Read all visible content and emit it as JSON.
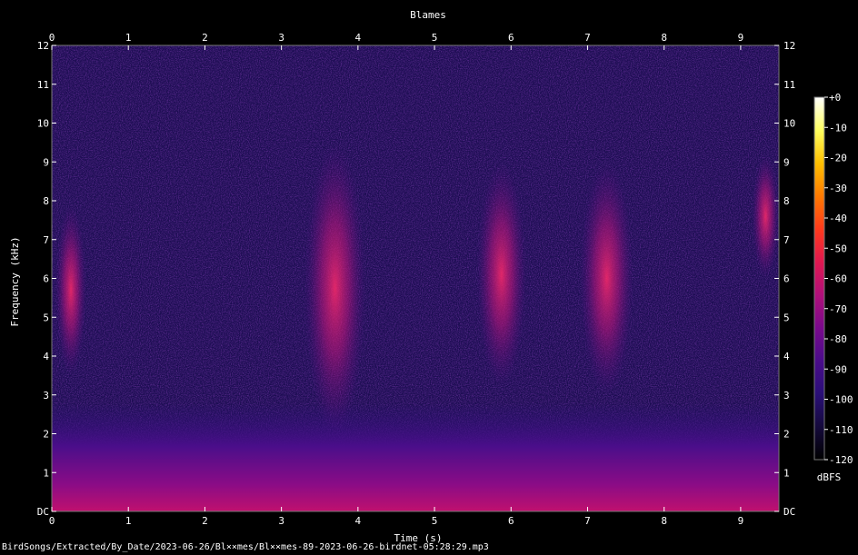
{
  "chart_data": {
    "type": "heatmap",
    "title": "Blames",
    "xlabel": "Time (s)",
    "ylabel": "Frequency (kHz)",
    "xlim": [
      0,
      9.5
    ],
    "ylim": [
      0,
      12
    ],
    "x_ticks": [
      0,
      1,
      2,
      3,
      4,
      5,
      6,
      7,
      8,
      9
    ],
    "x_tick_labels": [
      "0",
      "1",
      "2",
      "3",
      "4",
      "5",
      "6",
      "7",
      "8",
      "9"
    ],
    "y_ticks": [
      0,
      1,
      2,
      3,
      4,
      5,
      6,
      7,
      8,
      9,
      10,
      11,
      12
    ],
    "y_tick_labels": [
      "DC",
      "1",
      "2",
      "3",
      "4",
      "5",
      "6",
      "7",
      "8",
      "9",
      "10",
      "11",
      "12"
    ],
    "colorbar": {
      "label": "dBFS",
      "range": [
        -120,
        0
      ],
      "ticks": [
        0,
        -10,
        -20,
        -30,
        -40,
        -50,
        -60,
        -70,
        -80,
        -90,
        -100,
        -110,
        -120
      ],
      "tick_labels": [
        "+0",
        "-10",
        "-20",
        "-30",
        "-40",
        "-50",
        "-60",
        "-70",
        "-80",
        "-90",
        "-100",
        "-110",
        "-120"
      ],
      "colormap": [
        "#000000",
        "#150a3c",
        "#2a0f78",
        "#4a0c8a",
        "#7a0a8c",
        "#b0107a",
        "#e01850",
        "#ff3a1c",
        "#ff7a00",
        "#ffc000",
        "#ffff60",
        "#ffffff"
      ]
    },
    "background_db": -95,
    "low_freq_band": {
      "kHz_range": [
        0,
        2
      ],
      "level_db": [
        -60,
        -85
      ]
    },
    "bird_calls": [
      {
        "t_start": 0.05,
        "t_end": 0.45,
        "f_low_kHz": 3.5,
        "f_high_kHz": 7.9,
        "peak_db": -65
      },
      {
        "t_start": 3.3,
        "t_end": 4.1,
        "f_low_kHz": 2.0,
        "f_high_kHz": 9.5,
        "peak_db": -60
      },
      {
        "t_start": 5.55,
        "t_end": 6.2,
        "f_low_kHz": 3.2,
        "f_high_kHz": 9.0,
        "peak_db": -55
      },
      {
        "t_start": 6.9,
        "t_end": 7.6,
        "f_low_kHz": 3.0,
        "f_high_kHz": 9.0,
        "peak_db": -60
      },
      {
        "t_start": 9.15,
        "t_end": 9.5,
        "f_low_kHz": 6.0,
        "f_high_kHz": 9.2,
        "peak_db": -65
      }
    ]
  },
  "footer_text": "BirdSongs/Extracted/By_Date/2023-06-26/Bl××mes/Bl××mes-89-2023-06-26-birdnet-05:28:29.mp3"
}
